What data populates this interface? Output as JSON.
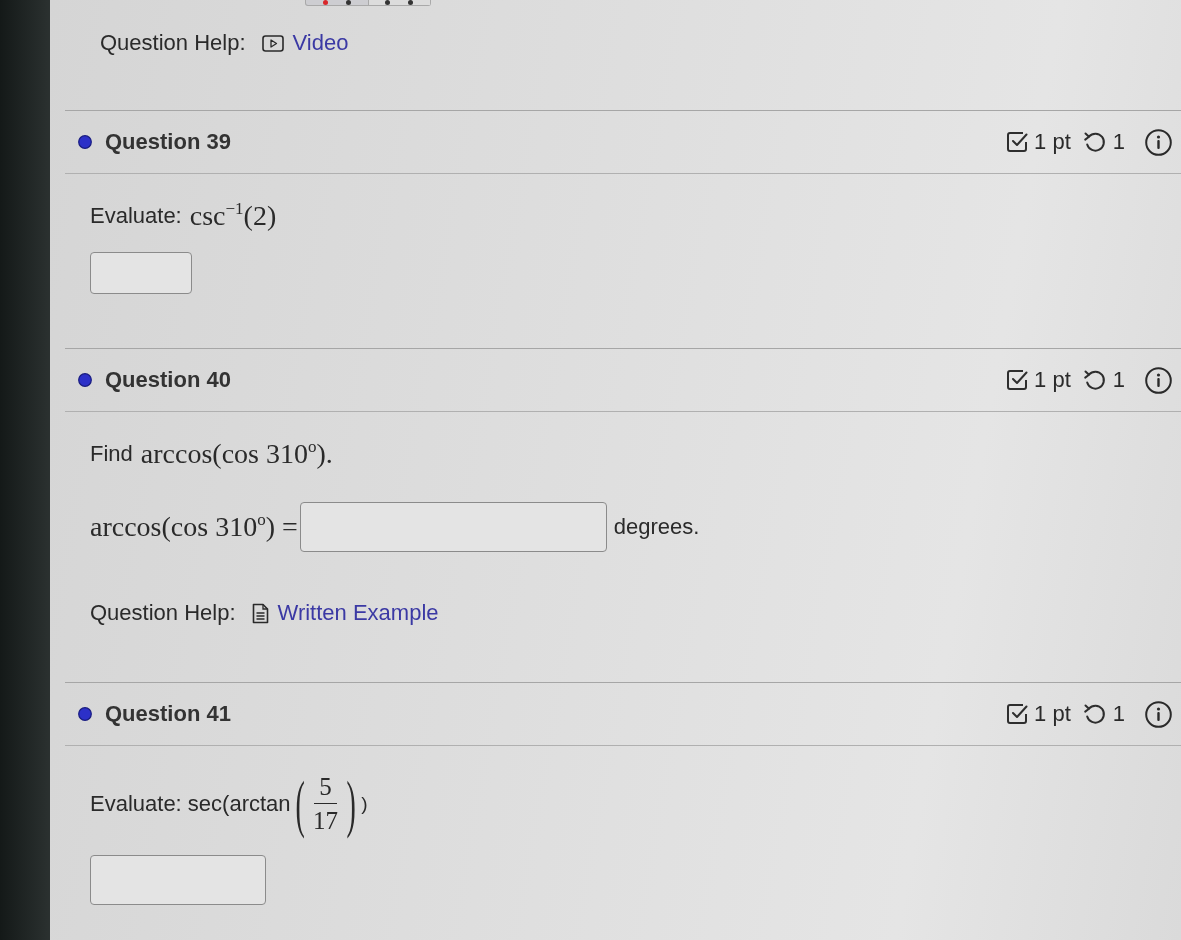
{
  "top_help": {
    "label": "Question Help:",
    "links": [
      {
        "kind": "video",
        "label": "Video"
      }
    ]
  },
  "questions": [
    {
      "title": "Question 39",
      "points": "1 pt",
      "attempts": "1",
      "prompt": {
        "text": "Evaluate:",
        "math": "csc$^{−1}$(2)"
      },
      "answer": {
        "kind": "box"
      }
    },
    {
      "title": "Question 40",
      "points": "1 pt",
      "attempts": "1",
      "prompt": {
        "text": "Find",
        "math": "arccos(cos 310$^{o}$)."
      },
      "answer": {
        "kind": "inline",
        "before": "arccos(cos 310$^{o}$) =",
        "after": "degrees."
      },
      "help": {
        "label": "Question Help:",
        "links": [
          {
            "kind": "written_example",
            "label": "Written Example"
          }
        ]
      }
    },
    {
      "title": "Question 41",
      "points": "1 pt",
      "attempts": "1",
      "prompt": {
        "text": "Evaluate: sec(arctan",
        "fraction": {
          "left": "(",
          "numerator": "5",
          "denominator": "17",
          "right": ")"
        },
        "after": ")"
      },
      "answer": {
        "kind": "box"
      }
    }
  ]
}
